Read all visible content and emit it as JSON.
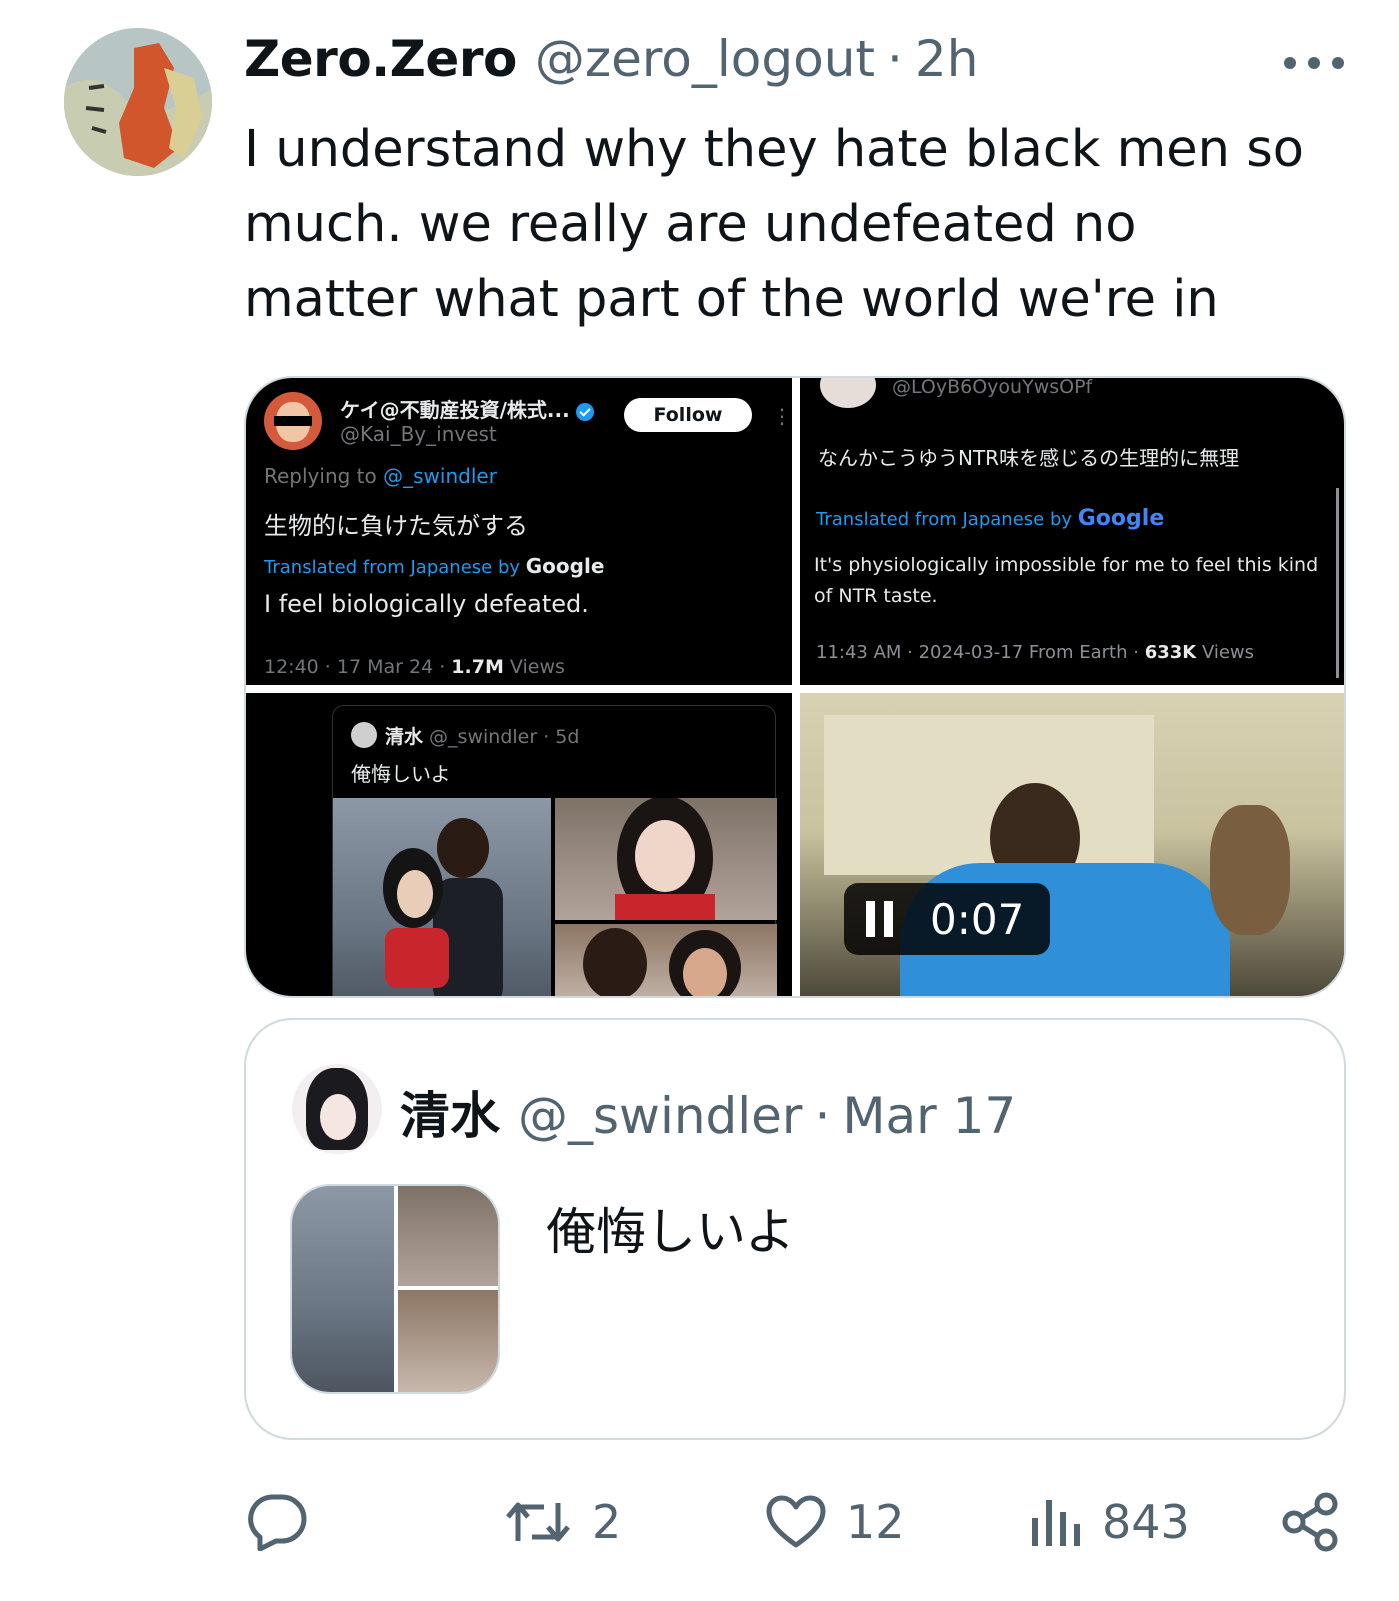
{
  "tweet": {
    "display_name": "Zero.Zero",
    "handle": "@zero_logout",
    "separator": "·",
    "time_ago": "2h",
    "text": "I understand why they hate black men so much. we really are undefeated no matter what part of the world we're in",
    "avatar_icon": "map-portugal-avatar"
  },
  "media": {
    "screenshot1": {
      "name": "ケイ@不動産投資/株式...",
      "handle": "@Kai_By_invest",
      "follow_label": "Follow",
      "more": "⋮",
      "replying_prefix": "Replying to ",
      "replying_handle": "@_swindler",
      "original_text": "生物的に負けた気がする",
      "translated_prefix": "Translated from Japanese by ",
      "translated_by": "Google",
      "translation": "I feel biologically defeated.",
      "meta_prefix": "12:40 · 17 Mar 24 · ",
      "views_count": "1.7M",
      "views_label": " Views"
    },
    "screenshot2": {
      "handle": "@LOyB6OyouYwsOPf",
      "original_text": "なんかこうゆうNTR味を感じるの生理的に無理",
      "translated_prefix": "Translated from Japanese by ",
      "translated_by": "Google",
      "translation": "It's physiologically impossible for me to feel this kind of NTR taste.",
      "meta_prefix": "11:43 AM · 2024-03-17 From Earth · ",
      "views_count": "633K",
      "views_label": " Views"
    },
    "screenshot3": {
      "name": "清水",
      "handle_time": " @_swindler · 5d",
      "text": "俺悔しいよ"
    },
    "video": {
      "time": "0:07",
      "state": "playing"
    }
  },
  "quote": {
    "display_name": "清水",
    "handle": "@_swindler",
    "separator": "·",
    "date": "Mar 17",
    "text": "俺悔しいよ"
  },
  "actions": {
    "reply_count": "",
    "retweet_count": "2",
    "like_count": "12",
    "views_count": "843"
  },
  "colors": {
    "text": "#0f1419",
    "secondary": "#536471",
    "border": "#cfd9de",
    "link": "#1d9bf0"
  }
}
